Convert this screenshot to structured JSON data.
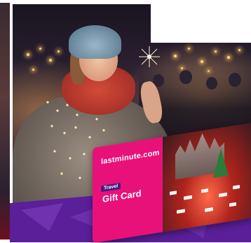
{
  "card": {
    "brand": "lastminute.com",
    "tag": "Travel",
    "title": "Gift Card"
  },
  "colors": {
    "card_pink": "#e8117a",
    "banner_purple": "#5b1f9a",
    "accent_teal": "#17b7b7",
    "tag_purple": "#4a1a7a"
  }
}
